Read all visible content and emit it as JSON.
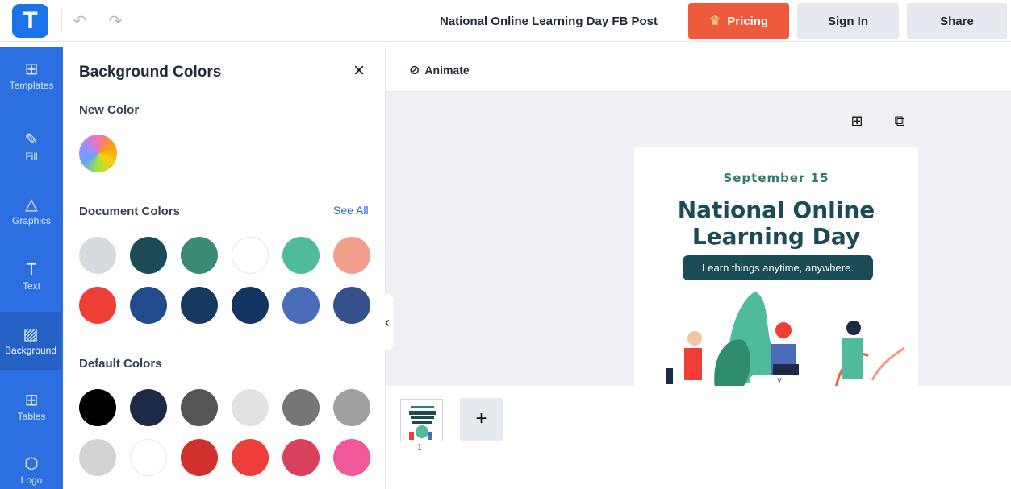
{
  "header": {
    "logo_letter": "T",
    "doc_title": "National Online Learning Day FB Post",
    "pricing_label": "Pricing",
    "signin_label": "Sign In",
    "share_label": "Share",
    "accent": "#f05a3c"
  },
  "sidebar": {
    "items": [
      {
        "label": "Templates",
        "icon": "templates-icon"
      },
      {
        "label": "Fill",
        "icon": "pencil-icon"
      },
      {
        "label": "Graphics",
        "icon": "shapes-icon"
      },
      {
        "label": "Text",
        "icon": "text-icon"
      },
      {
        "label": "Background",
        "icon": "background-icon"
      },
      {
        "label": "Tables",
        "icon": "table-icon"
      },
      {
        "label": "Logo",
        "icon": "logo-icon"
      }
    ],
    "active": "Background",
    "color": "#2b6fe0"
  },
  "panel": {
    "title": "Background Colors",
    "new_color_label": "New Color",
    "document_colors_label": "Document Colors",
    "see_all_label": "See All",
    "default_colors_label": "Default Colors",
    "document_colors": [
      "#d5dbe1",
      "#1b4b56",
      "#3a8a75",
      "#ffffff",
      "#4fbb9c",
      "#f2a08d",
      "#ef3e36",
      "#214b8c",
      "#163a5f",
      "#143461",
      "#4a6bb8",
      "#35518c"
    ],
    "default_colors": [
      "#000000",
      "#1e2847",
      "#555555",
      "#e2e2e2",
      "#767676",
      "#a0a0a0",
      "#d3d3d3",
      "#ffffff",
      "#d0312d",
      "#ef3e3a",
      "#d9405c",
      "#f0589a"
    ]
  },
  "canvas": {
    "animate_label": "Animate",
    "design": {
      "date": "September 15",
      "title_line1": "National Online",
      "title_line2": "Learning Day",
      "tagline": "Learn things anytime, anywhere."
    }
  },
  "pages": {
    "current_page": "1",
    "add_label": "+"
  }
}
